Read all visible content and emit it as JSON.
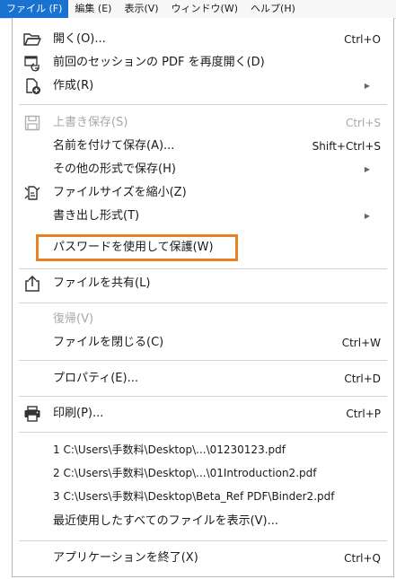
{
  "menubar": {
    "items": [
      "ファイル (F)",
      "編集 (E)",
      "表示(V)",
      "ウィンドウ(W)",
      "ヘルプ(H)"
    ],
    "active_index": 0
  },
  "menu": {
    "open": {
      "label": "開く(O)...",
      "shortcut": "Ctrl+O",
      "icon": "folder-open-icon"
    },
    "reopen": {
      "label": "前回のセッションの PDF を再度開く(D)",
      "icon": "reopen-session-icon"
    },
    "create": {
      "label": "作成(R)",
      "icon": "create-pdf-icon"
    },
    "save": {
      "label": "上書き保存(S)",
      "shortcut": "Ctrl+S",
      "icon": "save-icon",
      "disabled": true
    },
    "save_as": {
      "label": "名前を付けて保存(A)...",
      "shortcut": "Shift+Ctrl+S"
    },
    "save_other": {
      "label": "その他の形式で保存(H)"
    },
    "reduce_size": {
      "label": "ファイルサイズを縮小(Z)",
      "icon": "reduce-size-icon"
    },
    "export": {
      "label": "書き出し形式(T)"
    },
    "password": {
      "label": "パスワードを使用して保護(W)"
    },
    "share": {
      "label": "ファイルを共有(L)",
      "icon": "share-icon"
    },
    "revert": {
      "label": "復帰(V)",
      "disabled": true
    },
    "close": {
      "label": "ファイルを閉じる(C)",
      "shortcut": "Ctrl+W"
    },
    "properties": {
      "label": "プロパティ(E)...",
      "shortcut": "Ctrl+D"
    },
    "print": {
      "label": "印刷(P)...",
      "shortcut": "Ctrl+P",
      "icon": "print-icon"
    },
    "recent": [
      "1 C:\\Users\\手数料\\Desktop\\...\\01230123.pdf",
      "2 C:\\Users\\手数料\\Desktop\\...\\01Introduction2.pdf",
      "3 C:\\Users\\手数料\\Desktop\\Beta_Ref PDF\\Binder2.pdf"
    ],
    "show_all_recent": {
      "label": "最近使用したすべてのファイルを表示(V)..."
    },
    "exit": {
      "label": "アプリケーションを終了(X)",
      "shortcut": "Ctrl+Q"
    }
  },
  "colors": {
    "accent": "#1a72d0",
    "highlight_border": "#e98024",
    "disabled_text": "#a8a8a8"
  }
}
